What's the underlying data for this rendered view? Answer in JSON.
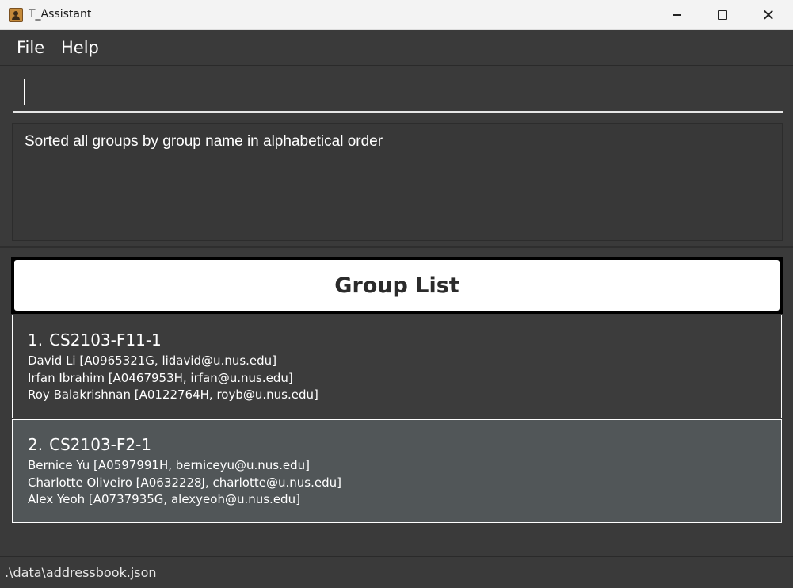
{
  "window": {
    "title": "T_Assistant",
    "icon": "app-person-icon"
  },
  "menu": {
    "file": "File",
    "help": "Help"
  },
  "command_box": {
    "value": "",
    "placeholder": ""
  },
  "result": {
    "message": "Sorted all groups by group name in alphabetical order"
  },
  "group_list": {
    "header": "Group List",
    "groups": [
      {
        "index": "1.",
        "name": "CS2103-F11-1",
        "members": [
          "David Li [A0965321G, lidavid@u.nus.edu]",
          "Irfan Ibrahim [A0467953H, irfan@u.nus.edu]",
          "Roy Balakrishnan [A0122764H, royb@u.nus.edu]"
        ]
      },
      {
        "index": "2.",
        "name": "CS2103-F2-1",
        "members": [
          "Bernice Yu [A0597991H, berniceyu@u.nus.edu]",
          "Charlotte Oliveiro [A0632228J, charlotte@u.nus.edu]",
          "Alex Yeoh [A0737935G, alexyeoh@u.nus.edu]"
        ]
      }
    ]
  },
  "status_bar": {
    "path": ".\\data\\addressbook.json"
  },
  "colors": {
    "background": "#3a3a3a",
    "selected_card": "#515658",
    "header_bg": "#ffffff"
  }
}
